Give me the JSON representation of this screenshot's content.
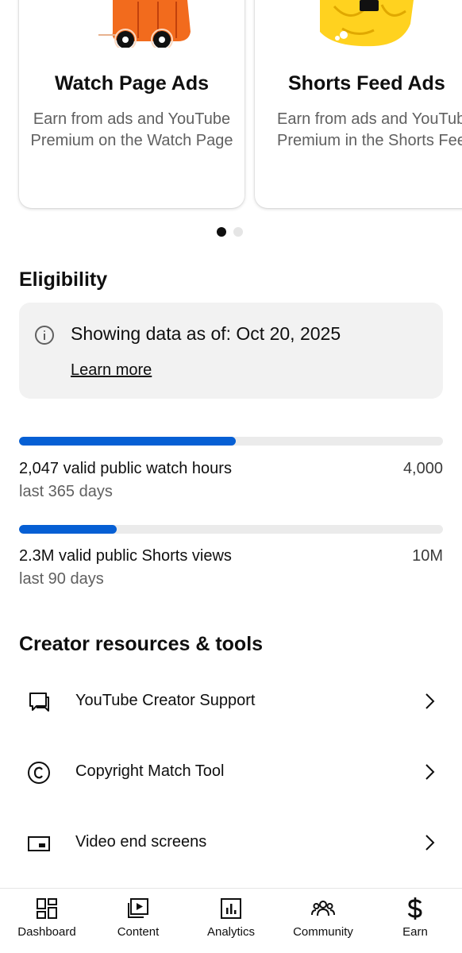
{
  "carousel": {
    "cards": [
      {
        "title": "Watch Page Ads",
        "description": "Earn from ads and YouTube Premium on the Watch Page"
      },
      {
        "title": "Shorts Feed Ads",
        "description": "Earn from ads and YouTube Premium in the Shorts Feed"
      }
    ],
    "active_index": 0,
    "page_count": 2
  },
  "eligibility": {
    "title": "Eligibility",
    "info_text": "Showing data as of: Oct 20, 2025",
    "learn_more": "Learn more",
    "metrics": [
      {
        "label": "2,047 valid public watch hours",
        "target": "4,000",
        "period": "last 365 days",
        "progress": 0.512
      },
      {
        "label": "2.3M valid public Shorts views",
        "target": "10M",
        "period": "last 90 days",
        "progress": 0.23
      }
    ]
  },
  "resources": {
    "title": "Creator resources & tools",
    "items": [
      {
        "label": "YouTube Creator Support",
        "icon": "chat-bubble-icon"
      },
      {
        "label": "Copyright Match Tool",
        "icon": "copyright-icon"
      },
      {
        "label": "Video end screens",
        "icon": "end-screen-icon"
      }
    ]
  },
  "bottom_nav": [
    {
      "label": "Dashboard",
      "icon": "dashboard-icon"
    },
    {
      "label": "Content",
      "icon": "content-icon"
    },
    {
      "label": "Analytics",
      "icon": "analytics-icon"
    },
    {
      "label": "Community",
      "icon": "community-icon"
    },
    {
      "label": "Earn",
      "icon": "earn-icon"
    }
  ],
  "colors": {
    "accent": "#065fd4",
    "track": "#ebebeb",
    "secondary_text": "#606060",
    "illustration_orange": "#f26b1d",
    "illustration_yellow": "#ffd21f"
  }
}
